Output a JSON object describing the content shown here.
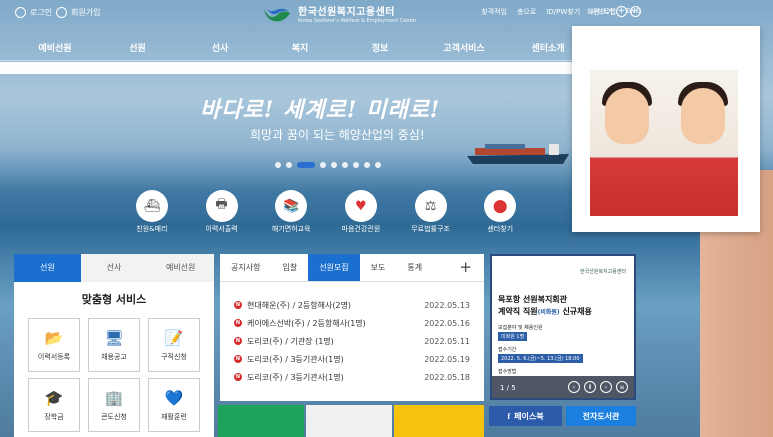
{
  "header": {
    "login": "로그인",
    "signup": "회원가입",
    "logo_ko": "한국선원복지고용센터",
    "logo_en": "Korea Seafarer's Welfare & Employment Center",
    "links": [
      "찾격적임",
      "총으로",
      "ID/PW찾기",
      "사이트맵",
      "ENG"
    ],
    "zoom_label": "화면크기",
    "zoom_in": "+",
    "zoom_out": "−"
  },
  "nav": [
    "예비선원",
    "선원",
    "선사",
    "복지",
    "정보",
    "고객서비스",
    "센터소개"
  ],
  "hero": {
    "headline": "바다로! 세계로! 미래로!",
    "subline": "희망과 꿈이 되는 해양산업의 중심!",
    "slide_count": 9,
    "active_slide": 1
  },
  "quick": [
    {
      "label": "친원&매리",
      "icon": "ship-icon",
      "glyph": "⛴"
    },
    {
      "label": "이력서출력",
      "icon": "printer-icon",
      "glyph": "🖶"
    },
    {
      "label": "해기면허교육",
      "icon": "books-icon",
      "glyph": "📚"
    },
    {
      "label": "마음건강관원",
      "icon": "heart-icon",
      "glyph": "♥"
    },
    {
      "label": "무료법률구조",
      "icon": "scales-icon",
      "glyph": "⚖"
    },
    {
      "label": "센터찾기",
      "icon": "location-pin-icon",
      "glyph": "📍"
    }
  ],
  "left_panel": {
    "tabs": [
      "선원",
      "선사",
      "예비선원"
    ],
    "active_tab": 0,
    "title": "맞춤형 서비스",
    "items": [
      {
        "label": "이력서등록",
        "icon": "folder-upload-icon",
        "glyph": "📂"
      },
      {
        "label": "채용공고",
        "icon": "monitor-icon",
        "glyph": "🖥"
      },
      {
        "label": "구직신청",
        "icon": "clipboard-pen-icon",
        "glyph": "📝"
      },
      {
        "label": "장학금",
        "icon": "graduation-cap-icon",
        "glyph": "🎓"
      },
      {
        "label": "콘도신청",
        "icon": "building-icon",
        "glyph": "🏢"
      },
      {
        "label": "재활훈련",
        "icon": "heart-hand-icon",
        "glyph": "💙"
      }
    ]
  },
  "news_panel": {
    "tabs": [
      "공지사항",
      "입찰",
      "선원모집",
      "보도",
      "통계"
    ],
    "active_tab": 2,
    "more": "+",
    "badge": "N",
    "rows": [
      {
        "title": "현대해운(주) / 2등항해사(2명)",
        "date": "2022.05.13"
      },
      {
        "title": "케이에스선박(주) / 2등항해사(1명)",
        "date": "2022.05.16"
      },
      {
        "title": "도리코(주) / 기관장 (1명)",
        "date": "2022.05.11"
      },
      {
        "title": "도리코(주) / 3등기관사(1명)",
        "date": "2022.05.19"
      },
      {
        "title": "도리코(주) / 3등기관사(1명)",
        "date": "2022.05.18"
      }
    ]
  },
  "poster": {
    "org": "한국선원복지고용센터",
    "line1": "목포항 선원복지회관",
    "line2_a": "계약직 직원",
    "line2_b": "(비화원)",
    "line2_c": "신규채용",
    "s1": "모집분야 및 채용인원",
    "tag1": "미화원 1명",
    "s2": "접수기간",
    "tag2": "2022. 5. 6.(금)~5. 13.(금) 18:00",
    "s3": "접수방법",
    "page": "1 / 5"
  },
  "bottom": {
    "facebook": "페이스북",
    "library": "전자도서관"
  }
}
